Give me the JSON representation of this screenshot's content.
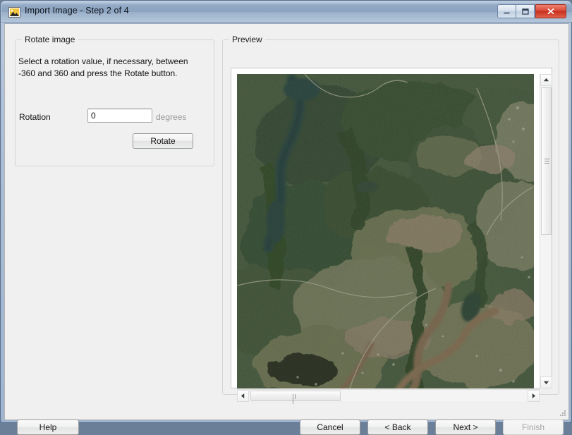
{
  "window": {
    "title": "Import Image - Step 2 of 4",
    "icon": "image-file-icon",
    "controls": {
      "minimize": "minimize-icon",
      "maximize": "maximize-icon",
      "close": "close-icon"
    },
    "titlebar_color": "#8ba3c0",
    "close_color": "#c7301d",
    "client_background": "#f0f0f0"
  },
  "left_panel": {
    "group_title": "Rotate image",
    "instructions": "Select a rotation value, if necessary, between -360 and 360 and press the Rotate button.",
    "rotation": {
      "label": "Rotation",
      "value": "0",
      "placeholder": "",
      "units": "degrees",
      "units_color": "#9a9a9a"
    },
    "rotate_button": "Rotate"
  },
  "preview_panel": {
    "group_title": "Preview",
    "image_description": "satellite-aerial-photograph",
    "vertical_scrollbar": {
      "up": "scroll-up-arrow-icon",
      "down": "scroll-down-arrow-icon",
      "thumb_position_percent": 2,
      "thumb_size_percent": 47
    },
    "horizontal_scrollbar": {
      "left": "scroll-left-arrow-icon",
      "right": "scroll-right-arrow-icon",
      "thumb_position_percent": 2,
      "thumb_size_percent": 30
    }
  },
  "footer": {
    "help": "Help",
    "cancel": "Cancel",
    "back": "< Back",
    "next": "Next >",
    "finish": "Finish",
    "finish_enabled": false
  }
}
